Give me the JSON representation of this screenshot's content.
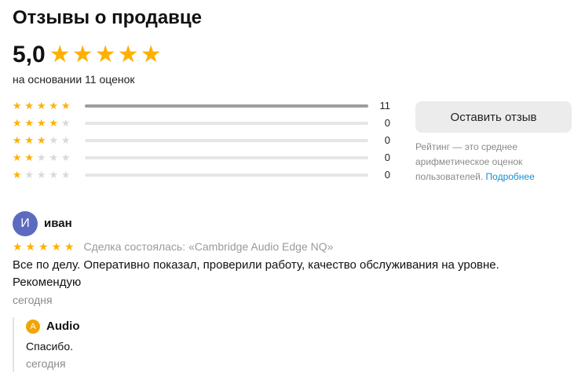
{
  "header": {
    "title": "Отзывы о продавце"
  },
  "summary": {
    "average": "5,0",
    "average_stars": 5,
    "basis_text": "на основании 11 оценок",
    "total": 11
  },
  "distribution": [
    {
      "stars": 5,
      "count": 11,
      "count_label": "11"
    },
    {
      "stars": 4,
      "count": 0,
      "count_label": "0"
    },
    {
      "stars": 3,
      "count": 0,
      "count_label": "0"
    },
    {
      "stars": 2,
      "count": 0,
      "count_label": "0"
    },
    {
      "stars": 1,
      "count": 0,
      "count_label": "0"
    }
  ],
  "actions": {
    "leave_review_label": "Оставить отзыв"
  },
  "rating_note": {
    "text": "Рейтинг — это среднее арифметическое оценок пользователей.",
    "link_label": "Подробнее"
  },
  "review": {
    "avatar_letter": "И",
    "author": "иван",
    "rating": 5,
    "deal": "Сделка состоялась: «Cambridge Audio Edge NQ»",
    "text": "Все по делу. Оперативно показал, проверили работу, качество обслуживания на уровне. Рекомендую",
    "date": "сегодня",
    "reply": {
      "avatar_letter": "A",
      "author": "Audio",
      "text": "Спасибо.",
      "date": "сегодня"
    }
  },
  "colors": {
    "star": "#ffb000",
    "star_empty": "#d9d9d9",
    "bar_fill": "#9d9d9d",
    "link": "#1a8ed1",
    "avatar_user": "#5c6bc0",
    "avatar_seller": "#f0a500"
  },
  "icons": {
    "star": "star-icon"
  }
}
